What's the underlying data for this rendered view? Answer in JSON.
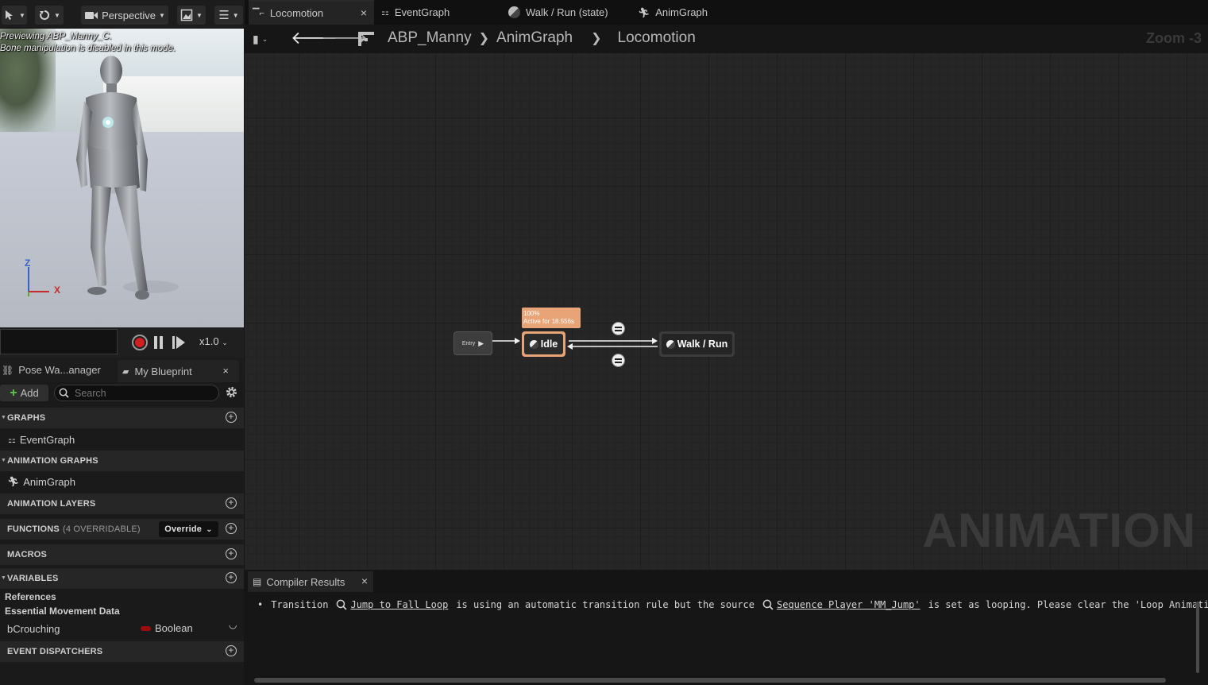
{
  "viewport": {
    "view_mode": "Perspective",
    "preview_text": "Previewing ABP_Manny_C.",
    "bone_text": "Bone manipulation is disabled in this mode.",
    "axis_z": "Z",
    "axis_x": "X",
    "speed": "x1.0"
  },
  "left_tabs": {
    "pose_watch": "Pose Wa...anager",
    "my_blueprint": "My Blueprint"
  },
  "my_blueprint": {
    "add_label": "Add",
    "search_placeholder": "Search",
    "sections": {
      "graphs": "GRAPHS",
      "animation_graphs": "ANIMATION GRAPHS",
      "animation_layers": "ANIMATION LAYERS",
      "functions": "FUNCTIONS",
      "functions_count": "(4 OVERRIDABLE)",
      "override": "Override",
      "macros": "MACROS",
      "variables": "VARIABLES",
      "event_dispatchers": "EVENT DISPATCHERS"
    },
    "items": {
      "event_graph": "EventGraph",
      "anim_graph": "AnimGraph"
    },
    "variable_categories": [
      "References",
      "Essential Movement Data"
    ],
    "variable": {
      "name": "bCrouching",
      "type": "Boolean",
      "type_color": "#9b0c0c"
    }
  },
  "graph_tabs": [
    {
      "label": "Locomotion",
      "close": "×"
    },
    {
      "label": "EventGraph"
    },
    {
      "label": "Walk / Run (state)"
    },
    {
      "label": "AnimGraph"
    }
  ],
  "breadcrumb": {
    "root": "ABP_Manny",
    "level1": "AnimGraph",
    "level2": "Locomotion",
    "zoom": "Zoom -3"
  },
  "graph": {
    "entry": "Entry",
    "idle": "Idle",
    "idle_weight": "100%",
    "idle_active": "Active for 18.556s",
    "walk_run": "Walk / Run",
    "watermark": "ANIMATION",
    "accent_active": "#e8a476"
  },
  "compiler": {
    "tab": "Compiler Results",
    "msg_1": "Transition",
    "link_1": "Jump to Fall Loop",
    "msg_2": "is using an automatic transition rule but the source",
    "link_2": "Sequence Player 'MM_Jump'",
    "msg_3": "is set as looping.  Please clear the 'Loop Animation"
  }
}
